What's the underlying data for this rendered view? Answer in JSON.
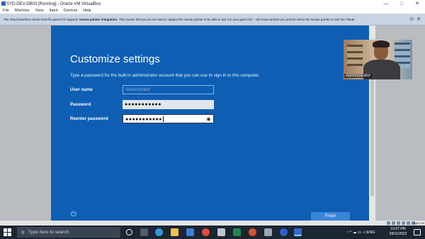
{
  "window": {
    "title": "SYD-DEV-DB03 [Running] - Oracle VM VirtualBox",
    "controls": [
      "—",
      "□",
      "✕"
    ]
  },
  "menu": [
    "File",
    "Machine",
    "View",
    "Input",
    "Devices",
    "Help"
  ],
  "notice": {
    "text_before": "The Virtual Machine reports that the guest OS supports",
    "bold": "mouse pointer integration.",
    "text_after": "This means that you do not need to capture the mouse pointer to be able to use it in your guest OS -- all mouse actions you perform when the mouse pointer is over the Virtual"
  },
  "vm_screen": {
    "heading": "Customize settings",
    "description": "Type a password for the built-in administrator account that you can use to sign in to this computer.",
    "user_name_label": "User name",
    "user_name_placeholder": "Administrator",
    "password_label": "Password",
    "password_value": "●●●●●●●●●●●",
    "reenter_label": "Reenter password",
    "reenter_value": "●●●●●●●●●●●",
    "finish_label": "Finish"
  },
  "webcam": {
    "name": "Administrator"
  },
  "statusbar": {
    "host_key": "Right Ctrl"
  },
  "taskbar": {
    "search_placeholder": "Type here to search",
    "language": "ENG",
    "time": "10:37 PM",
    "date": "28/11/2022",
    "tray_chevron": "^"
  },
  "colors": {
    "vm_blue": "#0e5fb4",
    "finish_blue": "#3a85d6",
    "taskbar": "#1c2532"
  }
}
